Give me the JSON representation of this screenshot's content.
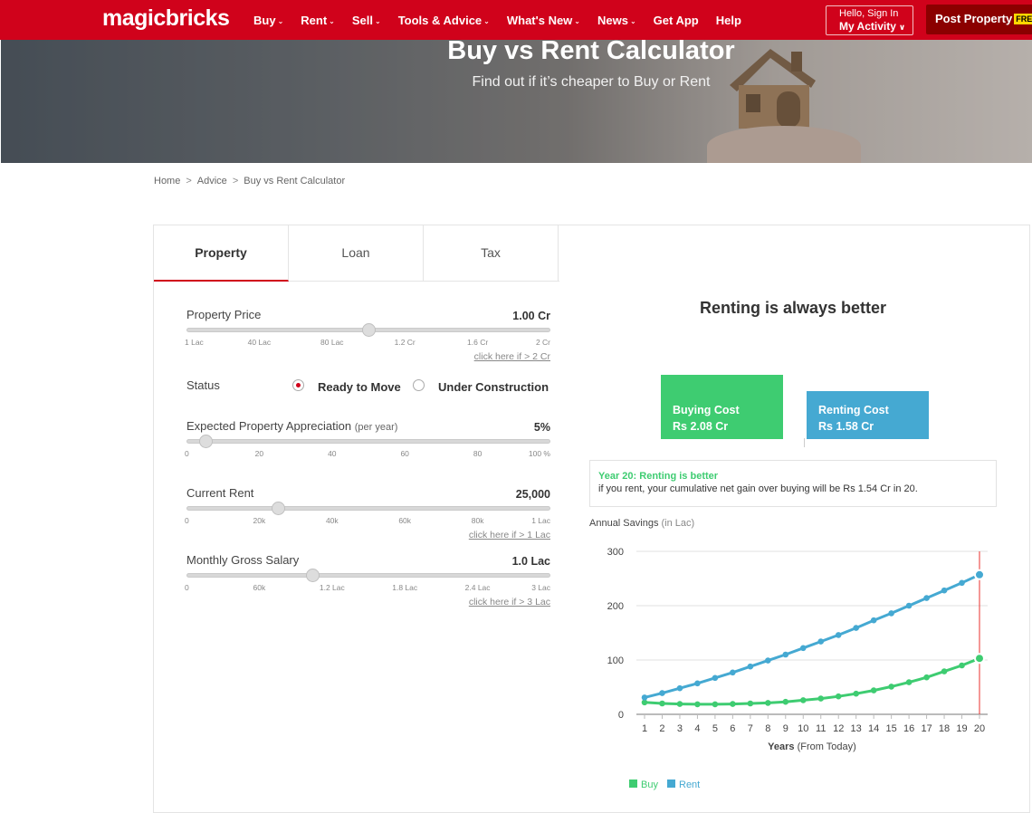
{
  "nav": {
    "logo": "magicbricks",
    "items": [
      {
        "label": "Buy",
        "dropdown": true
      },
      {
        "label": "Rent",
        "dropdown": true
      },
      {
        "label": "Sell",
        "dropdown": true
      },
      {
        "label": "Tools & Advice",
        "dropdown": true
      },
      {
        "label": "What's New",
        "dropdown": true
      },
      {
        "label": "News",
        "dropdown": true
      },
      {
        "label": "Get App",
        "dropdown": false
      },
      {
        "label": "Help",
        "dropdown": false
      }
    ],
    "signin_line1": "Hello, Sign In",
    "signin_line2": "My Activity",
    "post_label": "Post Property",
    "post_badge": "FREE",
    "bg_color": "#d0021b"
  },
  "hero": {
    "title": "Buy vs Rent Calculator",
    "subtitle": "Find out if it’s cheaper to Buy or Rent"
  },
  "breadcrumb": [
    "Home",
    "Advice",
    "Buy vs Rent Calculator"
  ],
  "tabs": [
    {
      "label": "Property",
      "active": true
    },
    {
      "label": "Loan",
      "active": false
    },
    {
      "label": "Tax",
      "active": false
    }
  ],
  "form": {
    "property_price": {
      "label": "Property Price",
      "value": "1.00 Cr",
      "level": 0.5,
      "ticks": [
        "1 Lac",
        "40 Lac",
        "80 Lac",
        "1.2 Cr",
        "1.6 Cr",
        "2 Cr"
      ],
      "more": "click here if > 2 Cr"
    },
    "status": {
      "label": "Status",
      "options": [
        "Ready to Move",
        "Under Construction"
      ],
      "selected": "Ready to Move"
    },
    "appreciation": {
      "label": "Expected Property Appreciation",
      "note": "(per year)",
      "value": "5%",
      "level": 0.05,
      "ticks": [
        "0",
        "20",
        "40",
        "60",
        "80",
        "100 %"
      ]
    },
    "current_rent": {
      "label": "Current Rent",
      "value": "25,000",
      "level": 0.25,
      "ticks": [
        "0",
        "20k",
        "40k",
        "60k",
        "80k",
        "1 Lac"
      ],
      "more": "click here if > 1 Lac"
    },
    "salary": {
      "label": "Monthly Gross Salary",
      "value": "1.0 Lac",
      "level": 0.345,
      "ticks": [
        "0",
        "60k",
        "1.2 Lac",
        "1.8 Lac",
        "2.4 Lac",
        "3 Lac"
      ],
      "more": "click here if > 3 Lac"
    }
  },
  "result": {
    "verdict": "Renting is always better",
    "buying_cost_label": "Buying Cost",
    "buying_cost_value": "Rs 2.08 Cr",
    "renting_cost_label": "Renting Cost",
    "renting_cost_value": "Rs 1.58 Cr",
    "summary_heading": "Year 20: Renting is better",
    "summary_text": "if you rent, your cumulative net gain over buying will be Rs 1.54 Cr in 20.",
    "annual_label": "Annual Savings",
    "annual_unit": "(in Lac)"
  },
  "chart_data": {
    "type": "line",
    "x": [
      1,
      2,
      3,
      4,
      5,
      6,
      7,
      8,
      9,
      10,
      11,
      12,
      13,
      14,
      15,
      16,
      17,
      18,
      19,
      20
    ],
    "series": [
      {
        "name": "Buy",
        "color": "#3ecc71",
        "values": [
          22,
          20,
          19,
          18.5,
          18.5,
          19,
          20,
          21,
          23,
          26,
          29,
          33,
          38,
          44,
          51,
          59,
          68,
          79,
          90,
          103
        ]
      },
      {
        "name": "Rent",
        "color": "#45a9d2",
        "values": [
          31,
          39,
          48,
          57,
          67,
          77,
          88,
          99,
          110,
          122,
          134,
          146,
          159,
          173,
          186,
          200,
          214,
          228,
          242,
          257
        ]
      }
    ],
    "ylim": [
      0,
      300
    ],
    "yticks": [
      0,
      100,
      200,
      300
    ],
    "xlabel": "Years",
    "xlabel_note": "(From Today)",
    "legend": "bottom-left",
    "highlight_x": 20,
    "highlight_color": "#e8312e"
  }
}
